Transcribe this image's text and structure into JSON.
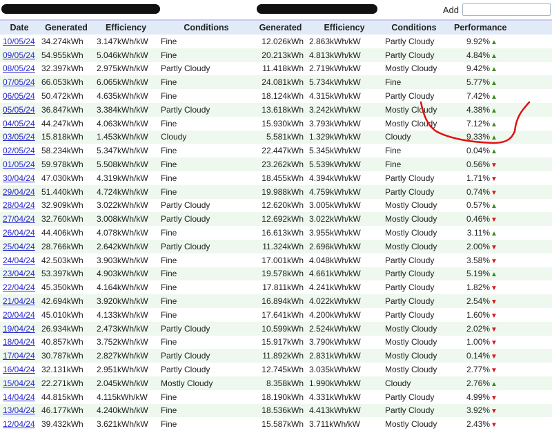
{
  "add": {
    "label": "Add",
    "value": ""
  },
  "headers": [
    "Date",
    "Generated",
    "Efficiency",
    "Conditions",
    "Generated",
    "Efficiency",
    "Conditions",
    "Performance"
  ],
  "colors": {
    "up": "#3a8a1e",
    "down": "#d41a1a",
    "annotation": "#e01010"
  },
  "rows": [
    [
      "10/05/24",
      "34.274kWh",
      "3.147kWh/kW",
      "Fine",
      "12.026kWh",
      "2.863kWh/kW",
      "Partly Cloudy",
      "9.92%",
      "up"
    ],
    [
      "09/05/24",
      "54.955kWh",
      "5.046kWh/kW",
      "Fine",
      "20.213kWh",
      "4.813kWh/kW",
      "Partly Cloudy",
      "4.84%",
      "up"
    ],
    [
      "08/05/24",
      "32.397kWh",
      "2.975kWh/kW",
      "Partly Cloudy",
      "11.418kWh",
      "2.719kWh/kW",
      "Mostly Cloudy",
      "9.42%",
      "up"
    ],
    [
      "07/05/24",
      "66.053kWh",
      "6.065kWh/kW",
      "Fine",
      "24.081kWh",
      "5.734kWh/kW",
      "Fine",
      "5.77%",
      "up"
    ],
    [
      "06/05/24",
      "50.472kWh",
      "4.635kWh/kW",
      "Fine",
      "18.124kWh",
      "4.315kWh/kW",
      "Partly Cloudy",
      "7.42%",
      "up"
    ],
    [
      "05/05/24",
      "36.847kWh",
      "3.384kWh/kW",
      "Partly Cloudy",
      "13.618kWh",
      "3.242kWh/kW",
      "Mostly Cloudy",
      "4.38%",
      "up"
    ],
    [
      "04/05/24",
      "44.247kWh",
      "4.063kWh/kW",
      "Fine",
      "15.930kWh",
      "3.793kWh/kW",
      "Mostly Cloudy",
      "7.12%",
      "up"
    ],
    [
      "03/05/24",
      "15.818kWh",
      "1.453kWh/kW",
      "Cloudy",
      "5.581kWh",
      "1.329kWh/kW",
      "Cloudy",
      "9.33%",
      "up"
    ],
    [
      "02/05/24",
      "58.234kWh",
      "5.347kWh/kW",
      "Fine",
      "22.447kWh",
      "5.345kWh/kW",
      "Fine",
      "0.04%",
      "up"
    ],
    [
      "01/05/24",
      "59.978kWh",
      "5.508kWh/kW",
      "Fine",
      "23.262kWh",
      "5.539kWh/kW",
      "Fine",
      "0.56%",
      "down"
    ],
    [
      "30/04/24",
      "47.030kWh",
      "4.319kWh/kW",
      "Fine",
      "18.455kWh",
      "4.394kWh/kW",
      "Partly Cloudy",
      "1.71%",
      "down"
    ],
    [
      "29/04/24",
      "51.440kWh",
      "4.724kWh/kW",
      "Fine",
      "19.988kWh",
      "4.759kWh/kW",
      "Partly Cloudy",
      "0.74%",
      "down"
    ],
    [
      "28/04/24",
      "32.909kWh",
      "3.022kWh/kW",
      "Partly Cloudy",
      "12.620kWh",
      "3.005kWh/kW",
      "Mostly Cloudy",
      "0.57%",
      "up"
    ],
    [
      "27/04/24",
      "32.760kWh",
      "3.008kWh/kW",
      "Partly Cloudy",
      "12.692kWh",
      "3.022kWh/kW",
      "Mostly Cloudy",
      "0.46%",
      "down"
    ],
    [
      "26/04/24",
      "44.406kWh",
      "4.078kWh/kW",
      "Fine",
      "16.613kWh",
      "3.955kWh/kW",
      "Mostly Cloudy",
      "3.11%",
      "up"
    ],
    [
      "25/04/24",
      "28.766kWh",
      "2.642kWh/kW",
      "Partly Cloudy",
      "11.324kWh",
      "2.696kWh/kW",
      "Mostly Cloudy",
      "2.00%",
      "down"
    ],
    [
      "24/04/24",
      "42.503kWh",
      "3.903kWh/kW",
      "Fine",
      "17.001kWh",
      "4.048kWh/kW",
      "Partly Cloudy",
      "3.58%",
      "down"
    ],
    [
      "23/04/24",
      "53.397kWh",
      "4.903kWh/kW",
      "Fine",
      "19.578kWh",
      "4.661kWh/kW",
      "Partly Cloudy",
      "5.19%",
      "up"
    ],
    [
      "22/04/24",
      "45.350kWh",
      "4.164kWh/kW",
      "Fine",
      "17.811kWh",
      "4.241kWh/kW",
      "Partly Cloudy",
      "1.82%",
      "down"
    ],
    [
      "21/04/24",
      "42.694kWh",
      "3.920kWh/kW",
      "Fine",
      "16.894kWh",
      "4.022kWh/kW",
      "Partly Cloudy",
      "2.54%",
      "down"
    ],
    [
      "20/04/24",
      "45.010kWh",
      "4.133kWh/kW",
      "Fine",
      "17.641kWh",
      "4.200kWh/kW",
      "Partly Cloudy",
      "1.60%",
      "down"
    ],
    [
      "19/04/24",
      "26.934kWh",
      "2.473kWh/kW",
      "Partly Cloudy",
      "10.599kWh",
      "2.524kWh/kW",
      "Mostly Cloudy",
      "2.02%",
      "down"
    ],
    [
      "18/04/24",
      "40.857kWh",
      "3.752kWh/kW",
      "Fine",
      "15.917kWh",
      "3.790kWh/kW",
      "Mostly Cloudy",
      "1.00%",
      "down"
    ],
    [
      "17/04/24",
      "30.787kWh",
      "2.827kWh/kW",
      "Partly Cloudy",
      "11.892kWh",
      "2.831kWh/kW",
      "Mostly Cloudy",
      "0.14%",
      "down"
    ],
    [
      "16/04/24",
      "32.131kWh",
      "2.951kWh/kW",
      "Partly Cloudy",
      "12.745kWh",
      "3.035kWh/kW",
      "Mostly Cloudy",
      "2.77%",
      "down"
    ],
    [
      "15/04/24",
      "22.271kWh",
      "2.045kWh/kW",
      "Mostly Cloudy",
      "8.358kWh",
      "1.990kWh/kW",
      "Cloudy",
      "2.76%",
      "up"
    ],
    [
      "14/04/24",
      "44.815kWh",
      "4.115kWh/kW",
      "Fine",
      "18.190kWh",
      "4.331kWh/kW",
      "Partly Cloudy",
      "4.99%",
      "down"
    ],
    [
      "13/04/24",
      "46.177kWh",
      "4.240kWh/kW",
      "Fine",
      "18.536kWh",
      "4.413kWh/kW",
      "Partly Cloudy",
      "3.92%",
      "down"
    ],
    [
      "12/04/24",
      "39.432kWh",
      "3.621kWh/kW",
      "Fine",
      "15.587kWh",
      "3.711kWh/kW",
      "Mostly Cloudy",
      "2.43%",
      "down"
    ]
  ]
}
